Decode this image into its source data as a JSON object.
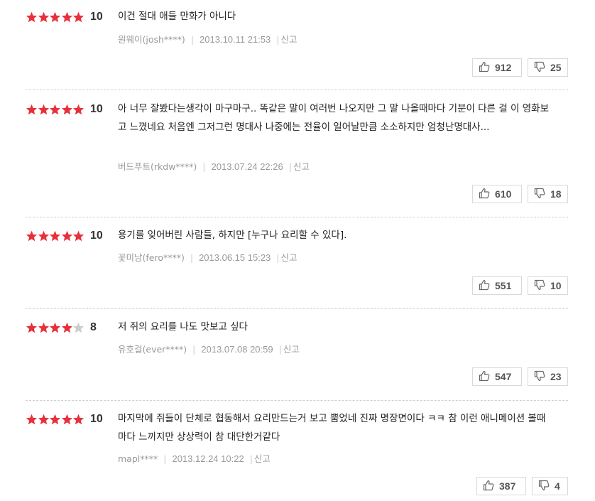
{
  "reviews": [
    {
      "rating": 5,
      "score": "10",
      "text": "이건 절대 애들 만화가 아니다",
      "author": "원웨이(josh****)",
      "date": "2013.10.11 21:53",
      "report": "신고",
      "likes": "912",
      "dislikes": "25"
    },
    {
      "rating": 5,
      "score": "10",
      "text": "아 너무 잘봤다는생각이 마구마구.. 똑같은 말이 여러번 나오지만 그 말 나올때마다 기분이 다른 걸 이 영화보고 느꼈네요 처음엔 그저그런 명대사 나중에는 전율이 일어날만큼 소소하지만 엄청난명대사...",
      "author": "버드푸트(rkdw****)",
      "date": "2013.07.24 22:26",
      "report": "신고",
      "likes": "610",
      "dislikes": "18"
    },
    {
      "rating": 5,
      "score": "10",
      "text": "용기를 잊어버린 사람들, 하지만 [누구나 요리할 수 있다].",
      "author": "꽃미남(fero****)",
      "date": "2013.06.15 15:23",
      "report": "신고",
      "likes": "551",
      "dislikes": "10"
    },
    {
      "rating": 4,
      "score": "8",
      "text": "저 쥐의 요리를 나도 맛보고 싶다",
      "author": "유호걸(ever****)",
      "date": "2013.07.08 20:59",
      "report": "신고",
      "likes": "547",
      "dislikes": "23"
    },
    {
      "rating": 5,
      "score": "10",
      "text": "마지막에 쥐들이 단체로 협동해서 요리만드는거 보고 뿜었네 진짜 명장면이다 ㅋㅋ 참 이런 애니메이션 볼때마다 느끼지만 상상력이 참 대단한거같다",
      "author": "mapl****",
      "date": "2013.12.24 10:22",
      "report": "신고",
      "likes": "387",
      "dislikes": "4"
    }
  ],
  "colors": {
    "star_filled": "#e8303a",
    "star_empty": "#cccccc"
  },
  "icons": {
    "like": "thumbs-up-icon",
    "dislike": "thumbs-down-icon"
  }
}
